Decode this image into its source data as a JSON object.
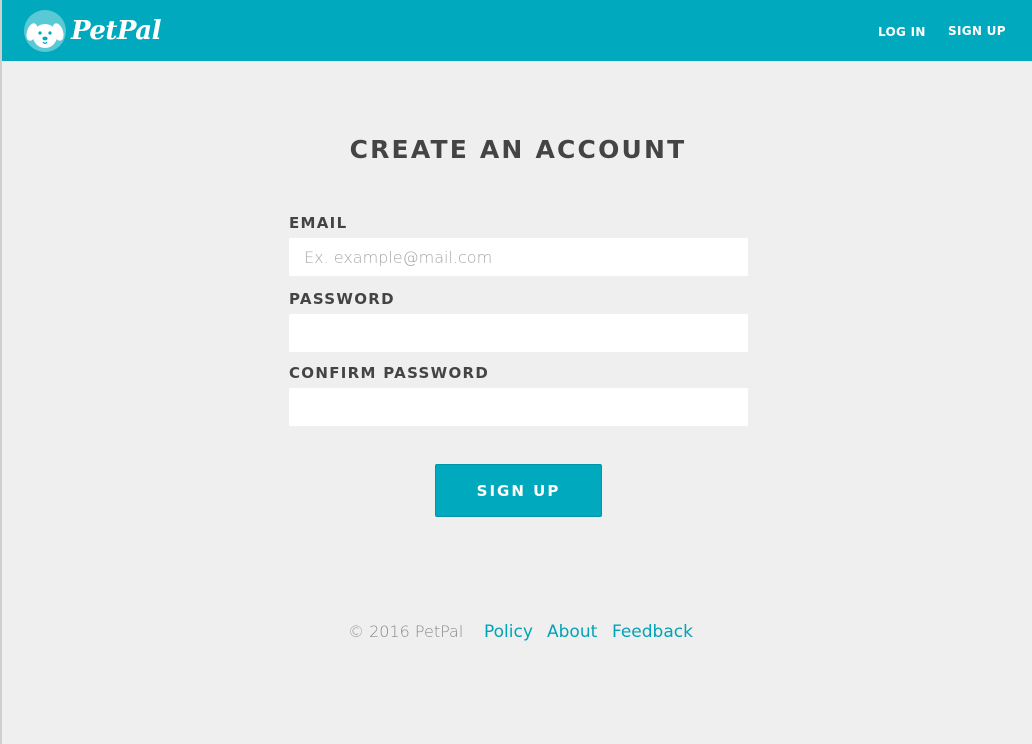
{
  "header": {
    "brand": "PetPal",
    "logo_icon": "dog-face-icon",
    "nav": {
      "login_label": "LOG IN",
      "signup_label": "SIGN UP"
    }
  },
  "form": {
    "title": "CREATE AN ACCOUNT",
    "fields": {
      "email": {
        "label": "EMAIL",
        "placeholder": "Ex. example@mail.com",
        "value": ""
      },
      "password": {
        "label": "PASSWORD",
        "placeholder": "",
        "value": ""
      },
      "confirm_password": {
        "label": "CONFIRM PASSWORD",
        "placeholder": "",
        "value": ""
      }
    },
    "submit_label": "SIGN UP"
  },
  "footer": {
    "copyright": "© 2016 PetPal",
    "links": {
      "policy": "Policy",
      "about": "About",
      "feedback": "Feedback"
    }
  },
  "colors": {
    "brand": "#00a9bd",
    "background": "#efefef",
    "text_dark": "#444444",
    "link": "#00a3b7"
  }
}
